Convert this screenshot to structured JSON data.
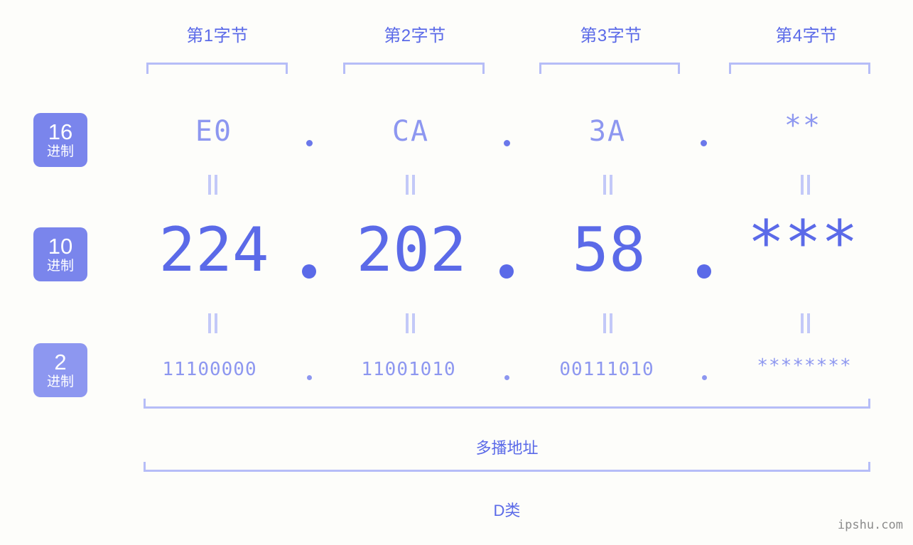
{
  "background_color": "#fdfdfa",
  "accent_color": "#5b6ae8",
  "accent_light_color": "#8d97f0",
  "bracket_color": "#b6bdf7",
  "badge_color": "#7a85ec",
  "headers": [
    {
      "label": "第1字节"
    },
    {
      "label": "第2字节"
    },
    {
      "label": "第3字节"
    },
    {
      "label": "第4字节"
    }
  ],
  "radix_badges": [
    {
      "number": "16",
      "unit": "进制"
    },
    {
      "number": "10",
      "unit": "进制"
    },
    {
      "number": "2",
      "unit": "进制"
    }
  ],
  "rows": {
    "hex": {
      "radix": "16",
      "values": [
        "E0",
        "CA",
        "3A",
        "**"
      ],
      "separator": "."
    },
    "dec": {
      "radix": "10",
      "values": [
        "224",
        "202",
        "58",
        "***"
      ],
      "separator": "."
    },
    "bin": {
      "radix": "2",
      "values": [
        "11100000",
        "11001010",
        "00111010",
        "********"
      ],
      "separator": "."
    }
  },
  "equality_marks": {
    "glyph": "=",
    "count_per_row": 4
  },
  "bands": [
    {
      "label": "多播地址"
    },
    {
      "label": "D类"
    }
  ],
  "watermark": {
    "text": "ipshu.com"
  }
}
